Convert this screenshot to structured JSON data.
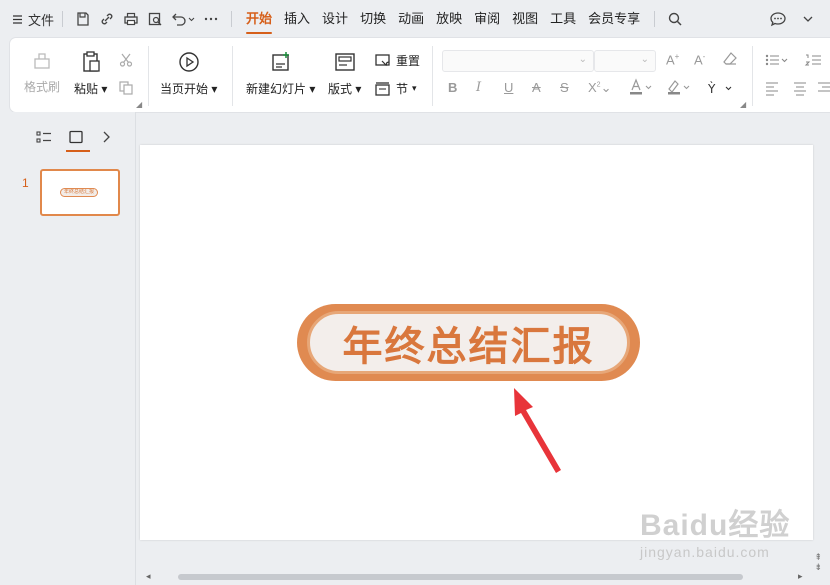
{
  "menubar": {
    "file_label": "文件",
    "tabs": [
      {
        "label": "开始",
        "active": true
      },
      {
        "label": "插入"
      },
      {
        "label": "设计"
      },
      {
        "label": "切换"
      },
      {
        "label": "动画"
      },
      {
        "label": "放映"
      },
      {
        "label": "审阅"
      },
      {
        "label": "视图"
      },
      {
        "label": "工具"
      },
      {
        "label": "会员专享"
      }
    ],
    "icons": [
      "menu-icon",
      "save-icon",
      "link-icon",
      "print-icon",
      "preview-icon",
      "undo-icon",
      "more-icon",
      "search-icon",
      "comment-icon"
    ]
  },
  "ribbon": {
    "format_painter": "格式刷",
    "paste": "粘贴",
    "play_from_current": "当页开始",
    "new_slide": "新建幻灯片",
    "layout": "版式",
    "reset": "重置",
    "section": "节"
  },
  "panel": {
    "slide_number": "1",
    "thumb_text": "年终总结汇报"
  },
  "slide": {
    "title": "年终总结汇报"
  },
  "watermark": {
    "brand": "Baidu经验",
    "url": "jingyan.baidu.com"
  },
  "colors": {
    "accent": "#d65f1a",
    "pill_border": "#e08a51",
    "pill_fill": "#f3eeeb",
    "title_text": "#d9773d",
    "arrow": "#e8343a"
  }
}
